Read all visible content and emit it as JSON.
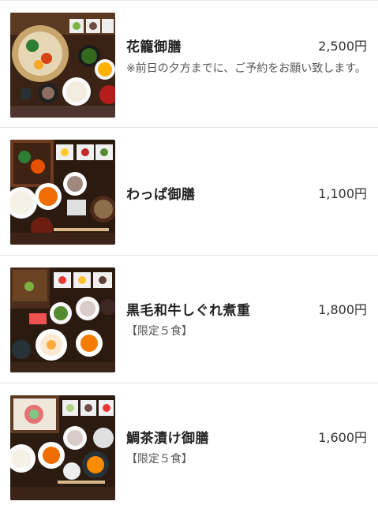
{
  "menu": {
    "items": [
      {
        "name": "花籠御膳",
        "price": "2,500円",
        "note": "※前日の夕方までに、ご予約をお願い致します。"
      },
      {
        "name": "わっぱ御膳",
        "price": "1,100円",
        "note": ""
      },
      {
        "name": "黒毛和牛しぐれ煮重",
        "price": "1,800円",
        "note": "【限定５食】"
      },
      {
        "name": "鯛茶漬け御膳",
        "price": "1,600円",
        "note": "【限定５食】"
      }
    ]
  }
}
